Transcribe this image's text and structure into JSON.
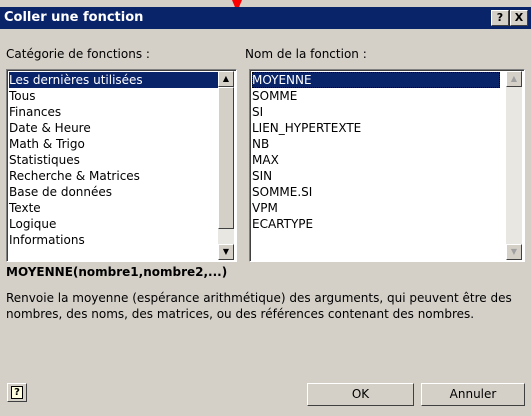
{
  "dialog": {
    "title": "Coller une fonction",
    "help_symbol": "?",
    "close_symbol": "X"
  },
  "categories": {
    "label": "Catégorie de fonctions :",
    "items": [
      "Les dernières utilisées",
      "Tous",
      "Finances",
      "Date & Heure",
      "Math & Trigo",
      "Statistiques",
      "Recherche & Matrices",
      "Base de données",
      "Texte",
      "Logique",
      "Informations"
    ],
    "selected": "Les dernières utilisées"
  },
  "functions": {
    "label": "Nom de la fonction :",
    "items": [
      "MOYENNE",
      "SOMME",
      "SI",
      "LIEN_HYPERTEXTE",
      "NB",
      "MAX",
      "SIN",
      "SOMME.SI",
      "VPM",
      "ECARTYPE"
    ],
    "selected": "MOYENNE"
  },
  "syntax": "MOYENNE(nombre1,nombre2,...)",
  "description": "Renvoie la moyenne (espérance arithmétique) des arguments, qui peuvent être des nombres, des noms, des matrices, ou des références contenant des nombres.",
  "buttons": {
    "ok": "OK",
    "cancel": "Annuler"
  },
  "colors": {
    "titlebar": "#0a246a",
    "selection": "#0a246a",
    "face": "#d4d0c8",
    "pointer": "#ff0000"
  }
}
